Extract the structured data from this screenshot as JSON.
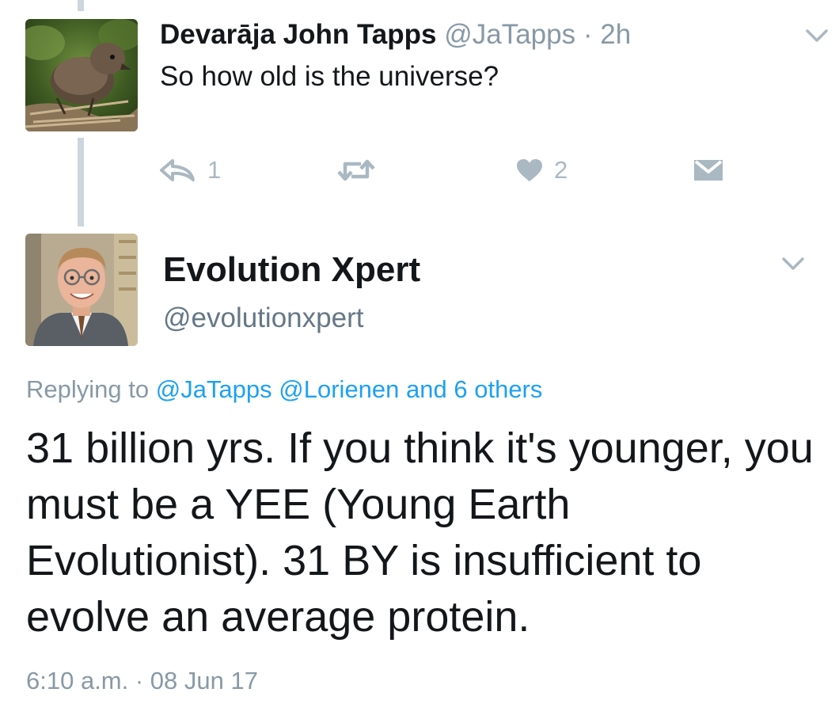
{
  "parent_tweet": {
    "name": "Devarāja John Tapps",
    "handle": "@JaTapps",
    "separator": "·",
    "time": "2h",
    "text": "So how old is the universe?",
    "reply_count": "1",
    "like_count": "2"
  },
  "main_tweet": {
    "name": "Evolution Xpert",
    "handle": "@evolutionxpert",
    "replying_prefix": "Replying to",
    "replying_user_1": "@JaTapps",
    "replying_user_2": "@Lorienen",
    "replying_others": "and 6 others",
    "body": "31 billion yrs. If you think it's younger, you must be a YEE (Young Earth Evolutionist). 31 BY is insufficient to evolve an average protein.",
    "timestamp": "6:10 a.m. · 08 Jun 17"
  },
  "colors": {
    "text": "#14171a",
    "secondary": "#8899a6",
    "icon": "#aab8c2",
    "link": "#1da1f2",
    "thread_line": "#ccd6dd"
  },
  "icons": {
    "reply": "reply-icon",
    "retweet": "retweet-icon",
    "like": "heart-icon",
    "dm": "envelope-icon",
    "menu": "chevron-down-icon"
  }
}
